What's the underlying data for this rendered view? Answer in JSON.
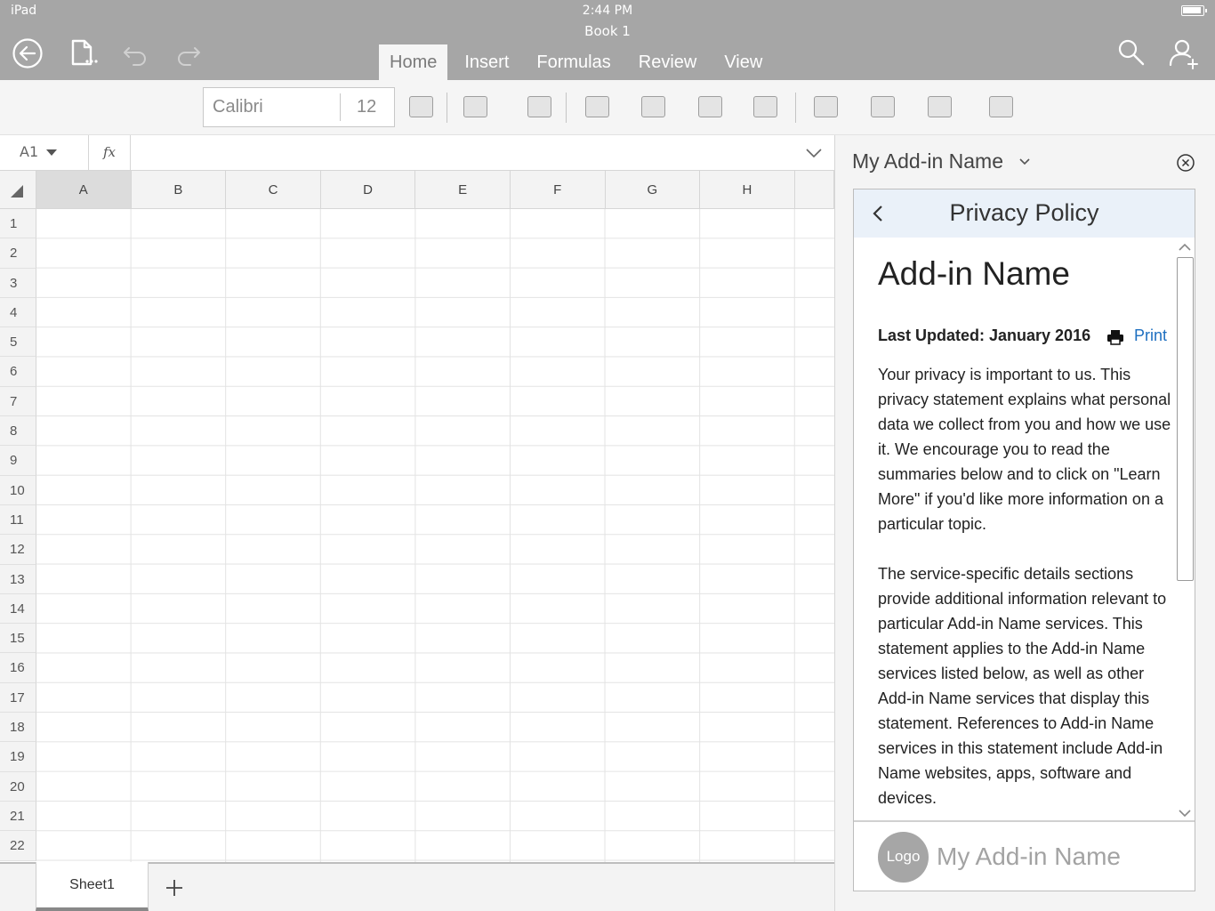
{
  "status": {
    "device": "iPad",
    "time": "2:44 PM",
    "document": "Book 1"
  },
  "ribbon": {
    "tabs": [
      {
        "label": "Home",
        "active": true
      },
      {
        "label": "Insert"
      },
      {
        "label": "Formulas"
      },
      {
        "label": "Review"
      },
      {
        "label": "View"
      }
    ]
  },
  "toolbar": {
    "font_name": "Calibri",
    "font_size": "12"
  },
  "formula_bar": {
    "cell_ref": "A1",
    "fx_label": "fx"
  },
  "grid": {
    "columns": [
      "A",
      "B",
      "C",
      "D",
      "E",
      "F",
      "G",
      "H"
    ],
    "rows": [
      "1",
      "2",
      "3",
      "4",
      "5",
      "6",
      "7",
      "8",
      "9",
      "10",
      "11",
      "12",
      "13",
      "14",
      "15",
      "16",
      "17",
      "18",
      "19",
      "20",
      "21",
      "22"
    ],
    "selected_column": "A"
  },
  "sheets": {
    "tabs": [
      "Sheet1"
    ]
  },
  "addin_pane": {
    "title": "My Add-in Name",
    "page_title": "Privacy Policy",
    "heading": "Add-in Name",
    "last_updated": "Last Updated: January 2016",
    "print_label": "Print",
    "paragraph1": "Your privacy is important to us. This privacy statement explains what personal data we collect from you and how we use it. We encourage you to read the summaries below and to click on \"Learn More\" if you'd like more information on a particular topic.",
    "paragraph2": "The service-specific details sections provide additional information relevant to particular Add-in Name services. This statement applies to the Add-in Name services listed below, as well as other Add-in Name services that display this statement. References to Add-in Name services in this statement include Add-in Name websites, apps, software and devices.",
    "logo_label": "Logo",
    "footer_name": "My Add-in Name",
    "link_color": "#1e6fc0",
    "header_color": "#eaf1f9"
  },
  "colors": {
    "chrome": "#a6a6a6",
    "toolbar": "#f5f5f5"
  }
}
